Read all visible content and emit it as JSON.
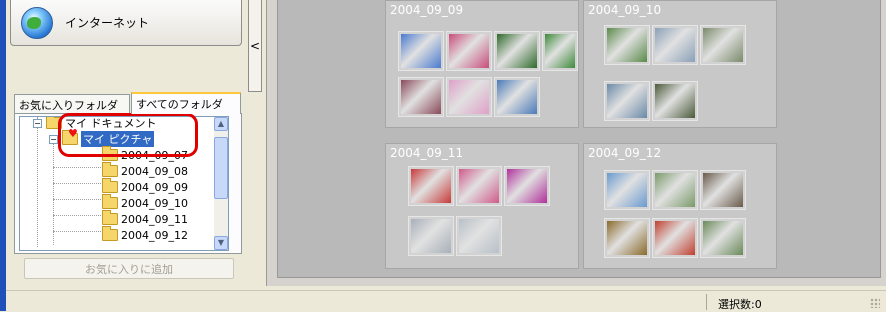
{
  "sidebar": {
    "internet_button_label": "インターネット",
    "collapse_glyph": "<",
    "tabs": [
      {
        "label": "お気に入りフォルダ",
        "active": false
      },
      {
        "label": "すべてのフォルダ",
        "active": true
      }
    ],
    "tree": {
      "root_label": "マイ ドキュメント",
      "selected_label": "マイ ピクチャ",
      "children": [
        "2004_09_07",
        "2004_09_08",
        "2004_09_09",
        "2004_09_10",
        "2004_09_11",
        "2004_09_12"
      ],
      "expander_collapse": "−"
    },
    "add_favorite_label": "お気に入りに追加"
  },
  "gallery": {
    "groups": [
      {
        "title": "2004_09_09",
        "thumb_colors": [
          "#4a7ad0",
          "#c94c7a",
          "#2f6a2a",
          "#3e8a3a",
          "#8a4a5a",
          "#e0a0c8",
          "#4a7ab8"
        ]
      },
      {
        "title": "2004_09_10",
        "thumb_colors": [
          "#5a8a4a",
          "#8aa0b8",
          "#7a8a6a",
          "#6a8aa8",
          "#4a5a3a"
        ]
      },
      {
        "title": "2004_09_11",
        "thumb_colors": [
          "#c83a3a",
          "#d05a8a",
          "#b0309a",
          "#a8b0b8",
          "#b8c0c8"
        ]
      },
      {
        "title": "2004_09_12",
        "thumb_colors": [
          "#6a9ad0",
          "#7a9a6a",
          "#6a5a4a",
          "#8a6a2a",
          "#c04030",
          "#6a8a5a"
        ]
      }
    ]
  },
  "status": {
    "selection_count": "選択数:0"
  }
}
